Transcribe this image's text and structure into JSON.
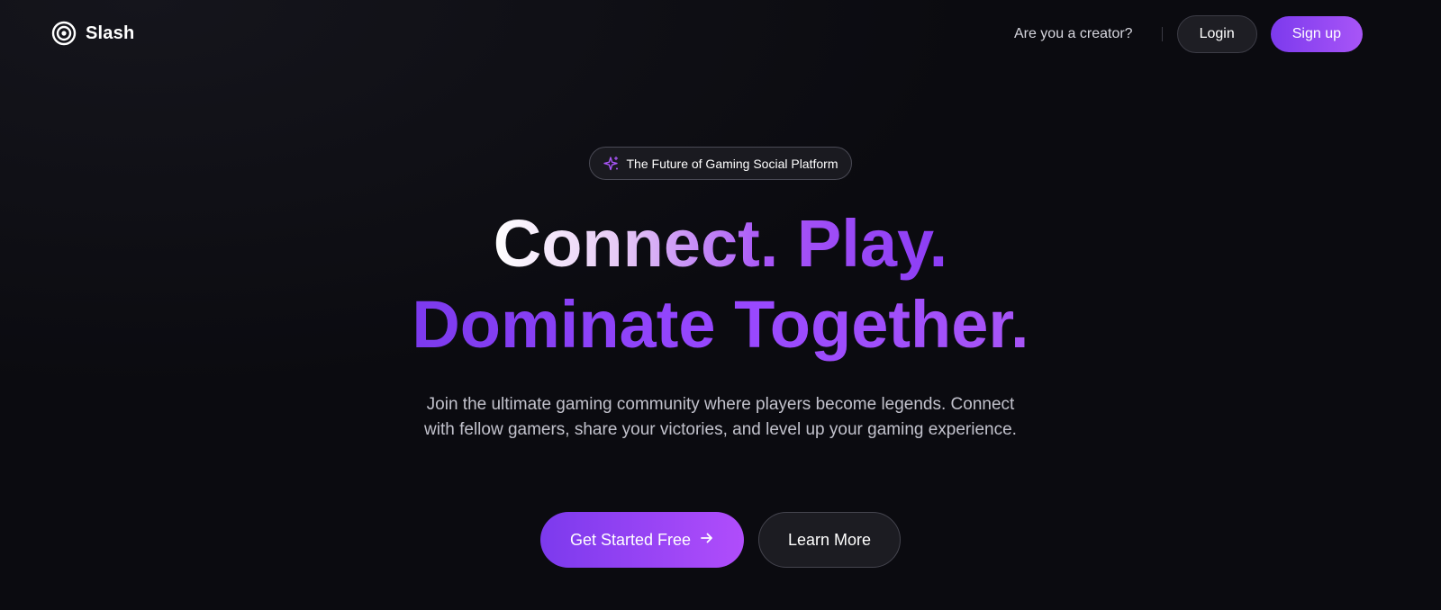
{
  "nav": {
    "logo_text": "Slash",
    "logo_icon": "target-icon",
    "creator_link": "Are you a creator?",
    "login_label": "Login",
    "signup_label": "Sign up"
  },
  "hero": {
    "badge_icon": "sparkle-icon",
    "badge_text": "The Future of Gaming Social Platform",
    "headline_line1": "Connect. Play.",
    "headline_line2": "Dominate Together.",
    "subtext": "Join the ultimate gaming community where players become legends. Connect with fellow gamers, share your victories, and level up your gaming experience.",
    "primary_cta": "Get Started Free",
    "primary_cta_icon": "arrow-right-icon",
    "secondary_cta": "Learn More"
  },
  "colors": {
    "background": "#0b0b10",
    "accent_start": "#7c3aed",
    "accent_end": "#a855f7",
    "muted_text": "#c2c2cc"
  }
}
